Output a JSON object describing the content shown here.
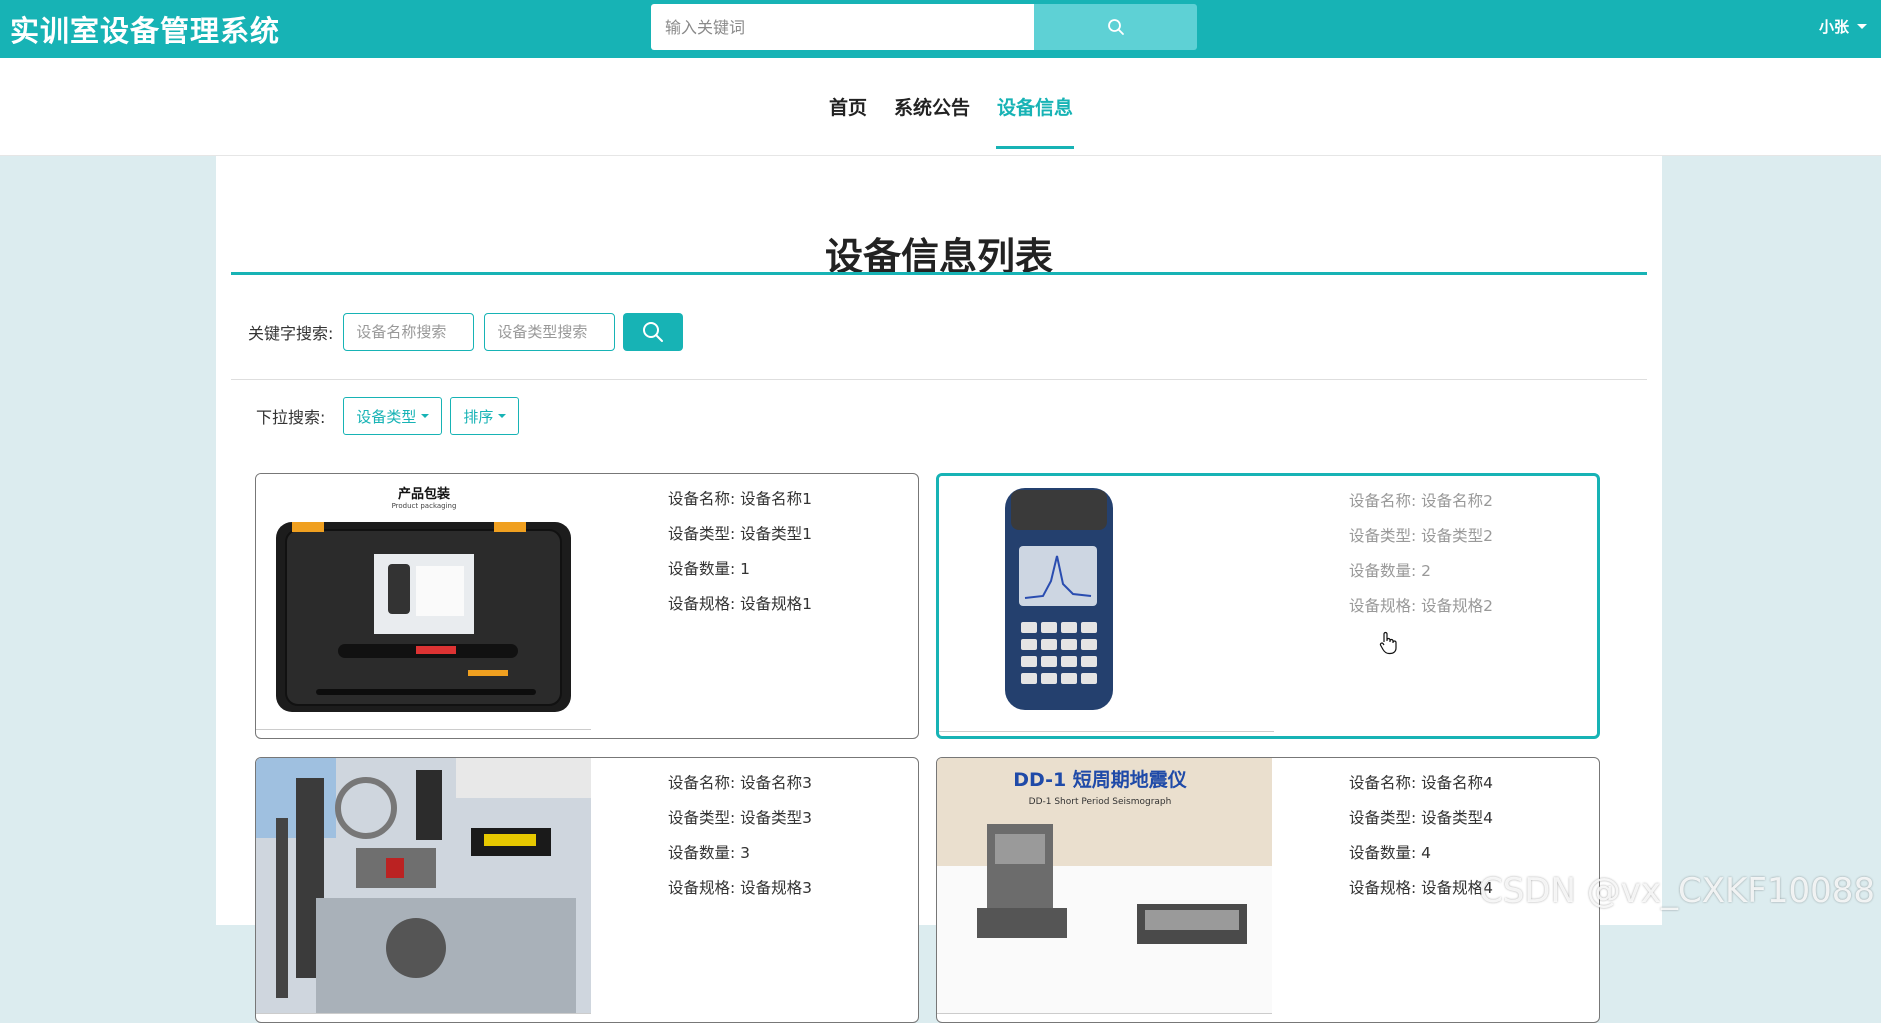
{
  "header": {
    "brand": "实训室设备管理系统",
    "search_placeholder": "输入关键词",
    "user": "小张"
  },
  "nav": {
    "items": [
      {
        "label": "首页"
      },
      {
        "label": "系统公告"
      },
      {
        "label": "设备信息",
        "active": true
      }
    ]
  },
  "page": {
    "title": "设备信息列表",
    "keyword_label": "关键字搜索:",
    "name_placeholder": "设备名称搜索",
    "type_placeholder": "设备类型搜索",
    "dropdown_label": "下拉搜索:",
    "dropdowns": [
      "设备类型",
      "排序"
    ]
  },
  "items": [
    {
      "name_label": "设备名称:",
      "name": "设备名称1",
      "type_label": "设备类型:",
      "type": "设备类型1",
      "qty_label": "设备数量:",
      "qty": "1",
      "spec_label": "设备规格:",
      "spec": "设备规格1",
      "image_caption": "产品包装",
      "image_sub": "Product packaging"
    },
    {
      "name_label": "设备名称:",
      "name": "设备名称2",
      "type_label": "设备类型:",
      "type": "设备类型2",
      "qty_label": "设备数量:",
      "qty": "2",
      "spec_label": "设备规格:",
      "spec": "设备规格2"
    },
    {
      "name_label": "设备名称:",
      "name": "设备名称3",
      "type_label": "设备类型:",
      "type": "设备类型3",
      "qty_label": "设备数量:",
      "qty": "3",
      "spec_label": "设备规格:",
      "spec": "设备规格3"
    },
    {
      "name_label": "设备名称:",
      "name": "设备名称4",
      "type_label": "设备类型:",
      "type": "设备类型4",
      "qty_label": "设备数量:",
      "qty": "4",
      "spec_label": "设备规格:",
      "spec": "设备规格4",
      "image_caption": "DD-1 短周期地震仪",
      "image_sub": "DD-1 Short Period Seismograph"
    }
  ],
  "watermark": "CSDN @vx_CXKF10088",
  "colors": {
    "accent": "#17b3b5",
    "background": "#dcecef"
  }
}
